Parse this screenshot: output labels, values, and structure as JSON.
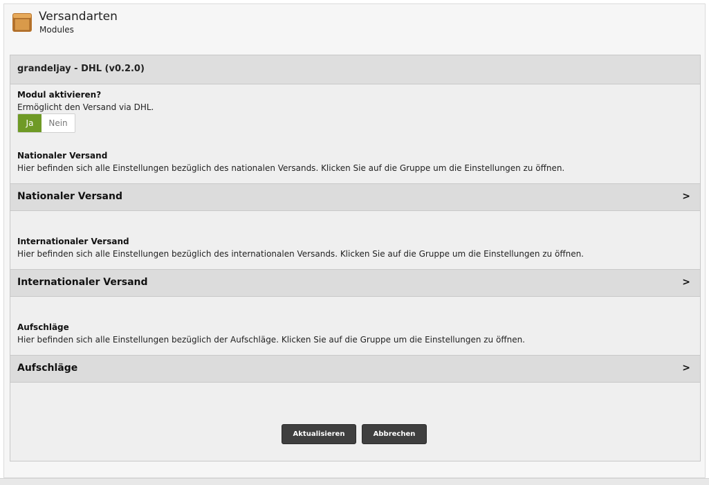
{
  "header": {
    "title": "Versandarten",
    "subtitle": "Modules",
    "icon": "box-icon"
  },
  "panel": {
    "title": "grandeljay - DHL (v0.2.0)",
    "activate": {
      "label": "Modul aktivieren?",
      "description": "Ermöglicht den Versand via DHL.",
      "options": [
        "Ja",
        "Nein"
      ],
      "selected": "Ja"
    },
    "groups": [
      {
        "heading": "Nationaler Versand",
        "description": "Hier befinden sich alle Einstellungen bezüglich des nationalen Versands. Klicken Sie auf die Gruppe um die Einstellungen zu öffnen.",
        "bar_label": "Nationaler Versand",
        "chevron": ">"
      },
      {
        "heading": "Internationaler Versand",
        "description": "Hier befinden sich alle Einstellungen bezüglich des internationalen Versands. Klicken Sie auf die Gruppe um die Einstellungen zu öffnen.",
        "bar_label": "Internationaler Versand",
        "chevron": ">"
      },
      {
        "heading": "Aufschläge",
        "description": "Hier befinden sich alle Einstellungen bezüglich der Aufschläge. Klicken Sie auf die Gruppe um die Einstellungen zu öffnen.",
        "bar_label": "Aufschläge",
        "chevron": ">"
      }
    ],
    "buttons": {
      "update": "Aktualisieren",
      "cancel": "Abbrechen"
    }
  },
  "colors": {
    "toggle_active": "#6f9a26",
    "button_bg": "#3f3f3f",
    "icon_box": "#d99a4a"
  }
}
